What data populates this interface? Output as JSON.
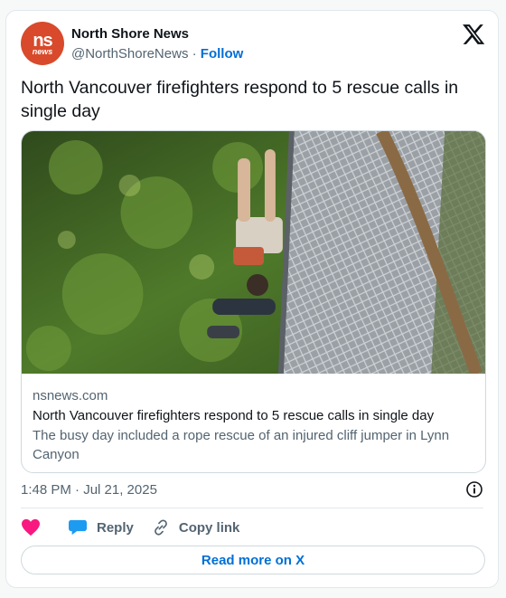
{
  "tweet": {
    "author_name": "North Shore News",
    "author_handle": "@NorthShoreNews",
    "separator": "·",
    "follow_label": "Follow",
    "avatar_text_top": "ns",
    "avatar_text_bottom": "news",
    "text": "North Vancouver firefighters respond to 5 rescue calls in single day",
    "timestamp": "1:48 PM · Jul 21, 2025"
  },
  "link_card": {
    "domain": "nsnews.com",
    "title": "North Vancouver firefighters respond to 5 rescue calls in single day",
    "description": "The busy day included a rope rescue of an injured cliff jumper in Lynn Canyon"
  },
  "actions": {
    "like_icon": "heart-icon",
    "reply_label": "Reply",
    "copy_link_label": "Copy link"
  },
  "footer": {
    "read_more_label": "Read more on X"
  },
  "colors": {
    "avatar_bg": "#d84a2b",
    "link_blue": "#006fd6",
    "heart": "#f91880",
    "reply_bubble": "#1d9bf0"
  }
}
